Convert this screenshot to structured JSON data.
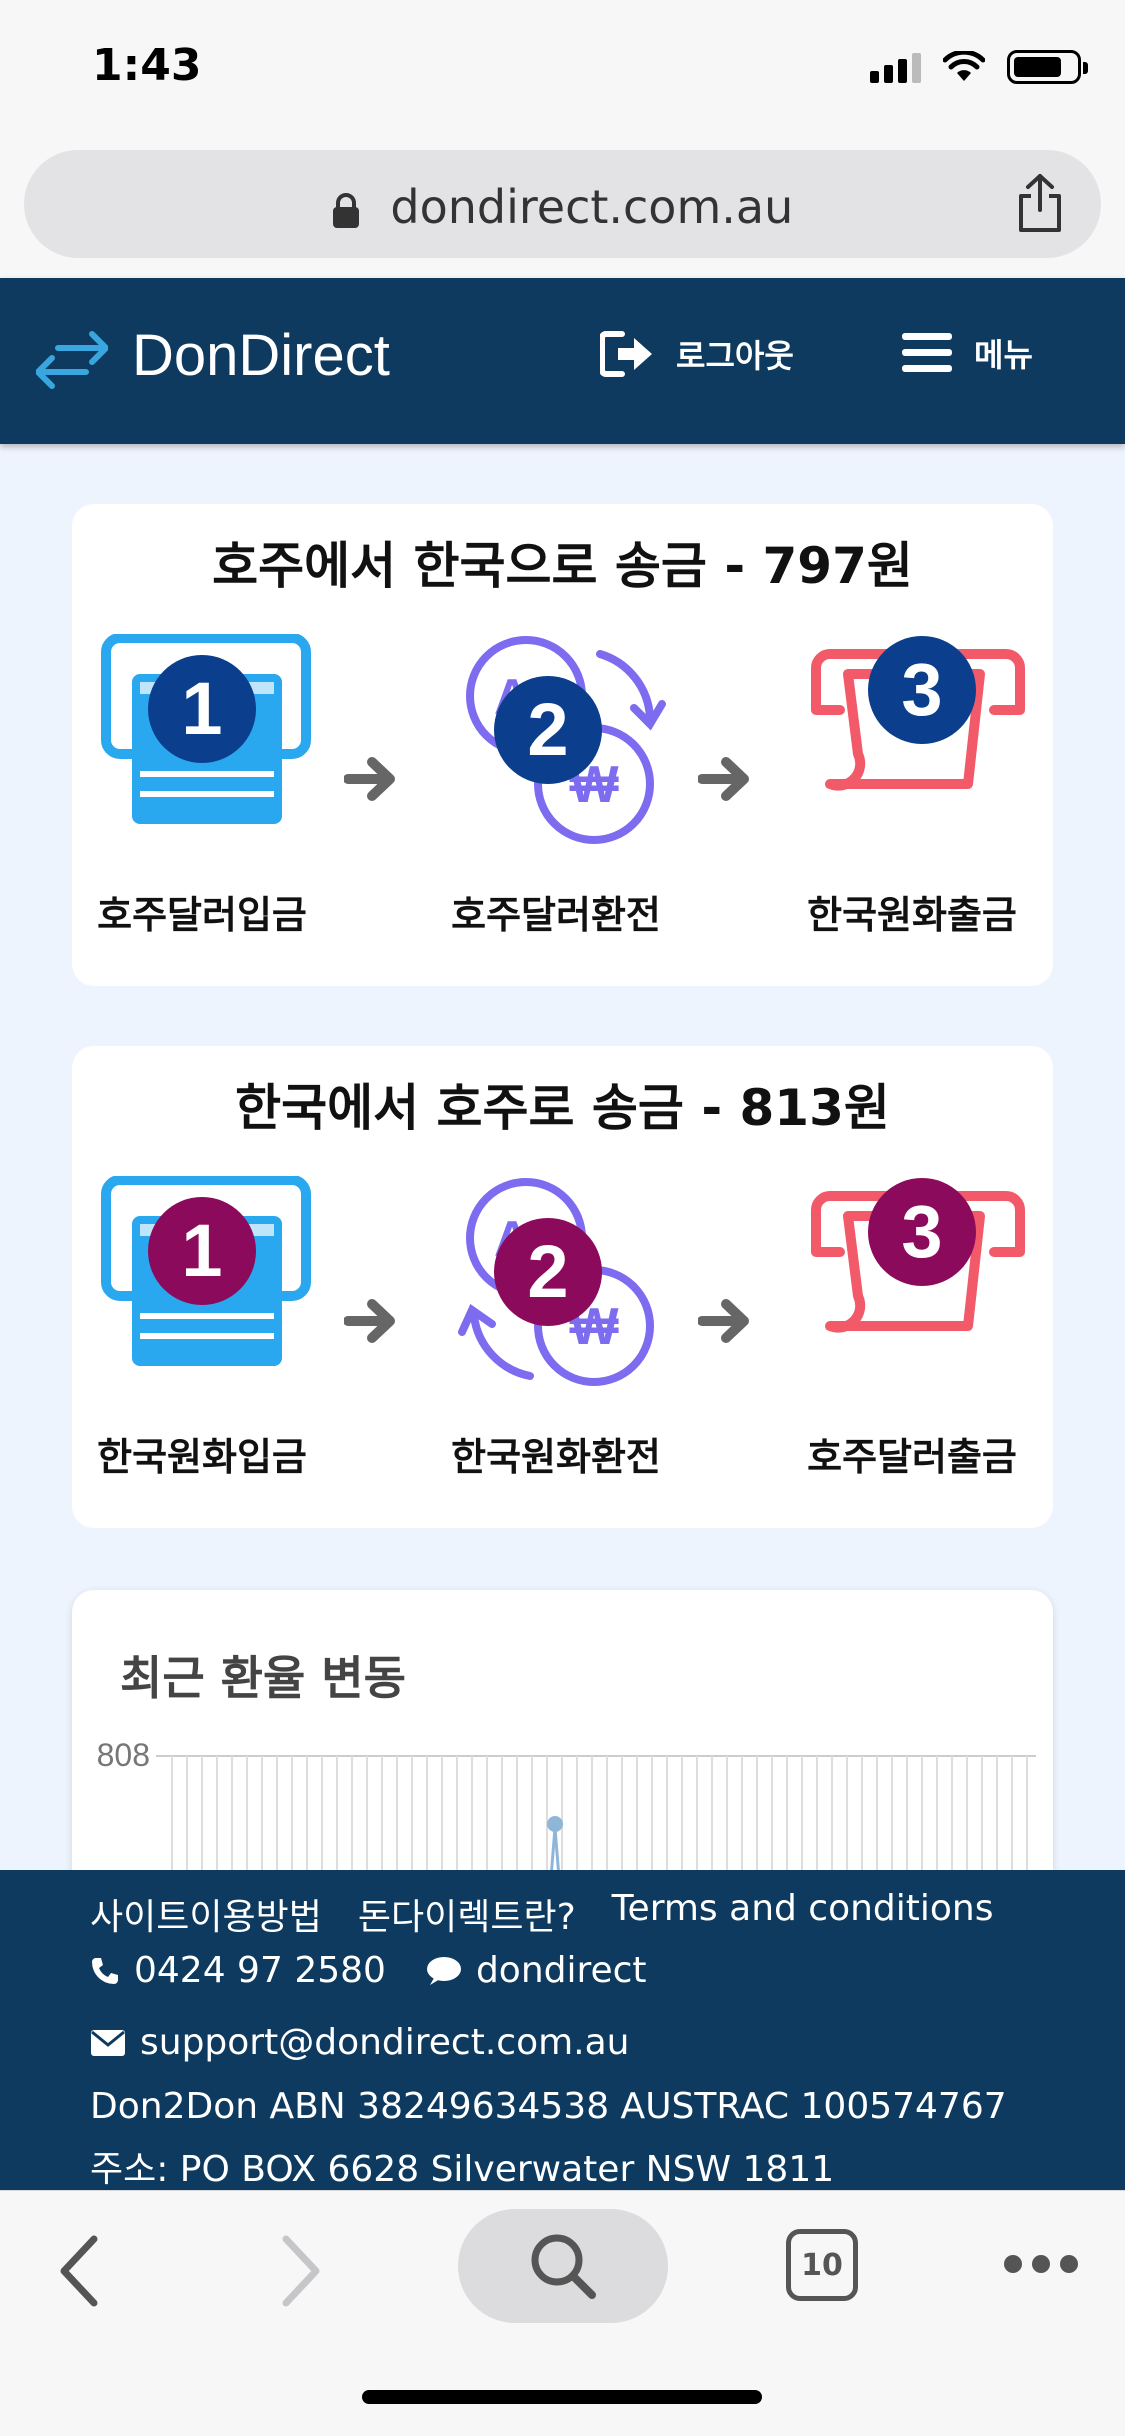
{
  "status_bar": {
    "time": "1:43"
  },
  "browser": {
    "url": "dondirect.com.au",
    "tab_count": "10"
  },
  "header": {
    "brand": "DonDirect",
    "logout_label": "로그아웃",
    "menu_label": "메뉴"
  },
  "colors": {
    "header_bg": "#0d3a5e",
    "badge_blue": "#0b3e8c",
    "badge_purple": "#8c0a5c",
    "atm_blue": "#29a7ef",
    "exchange_purple": "#7d6cef",
    "withdraw_red": "#f25a6a"
  },
  "cards": [
    {
      "title": "호주에서 한국으로 송금 - 797원",
      "steps": [
        {
          "number": "1",
          "label": "호주달러입금",
          "icon": "deposit-icon"
        },
        {
          "number": "2",
          "label": "호주달러환전",
          "icon": "exchange-icon"
        },
        {
          "number": "3",
          "label": "한국원화출금",
          "icon": "withdraw-icon"
        }
      ]
    },
    {
      "title": "한국에서 호주로 송금 - 813원",
      "steps": [
        {
          "number": "1",
          "label": "한국원화입금",
          "icon": "deposit-icon"
        },
        {
          "number": "2",
          "label": "한국원화환전",
          "icon": "exchange-icon"
        },
        {
          "number": "3",
          "label": "호주달러출금",
          "icon": "withdraw-icon"
        }
      ]
    }
  ],
  "chart": {
    "title": "최근 환율 변동",
    "y_top_label": "808"
  },
  "footer": {
    "links": [
      "사이트이용방법",
      "돈다이렉트란?",
      "Terms and conditions"
    ],
    "phone": "0424 97 2580",
    "kakao": "dondirect",
    "email": "support@dondirect.com.au",
    "abn_line": "Don2Don ABN 38249634538 AUSTRAC 100574767",
    "address_line": "주소: PO BOX 6628 Silverwater NSW 1811"
  }
}
